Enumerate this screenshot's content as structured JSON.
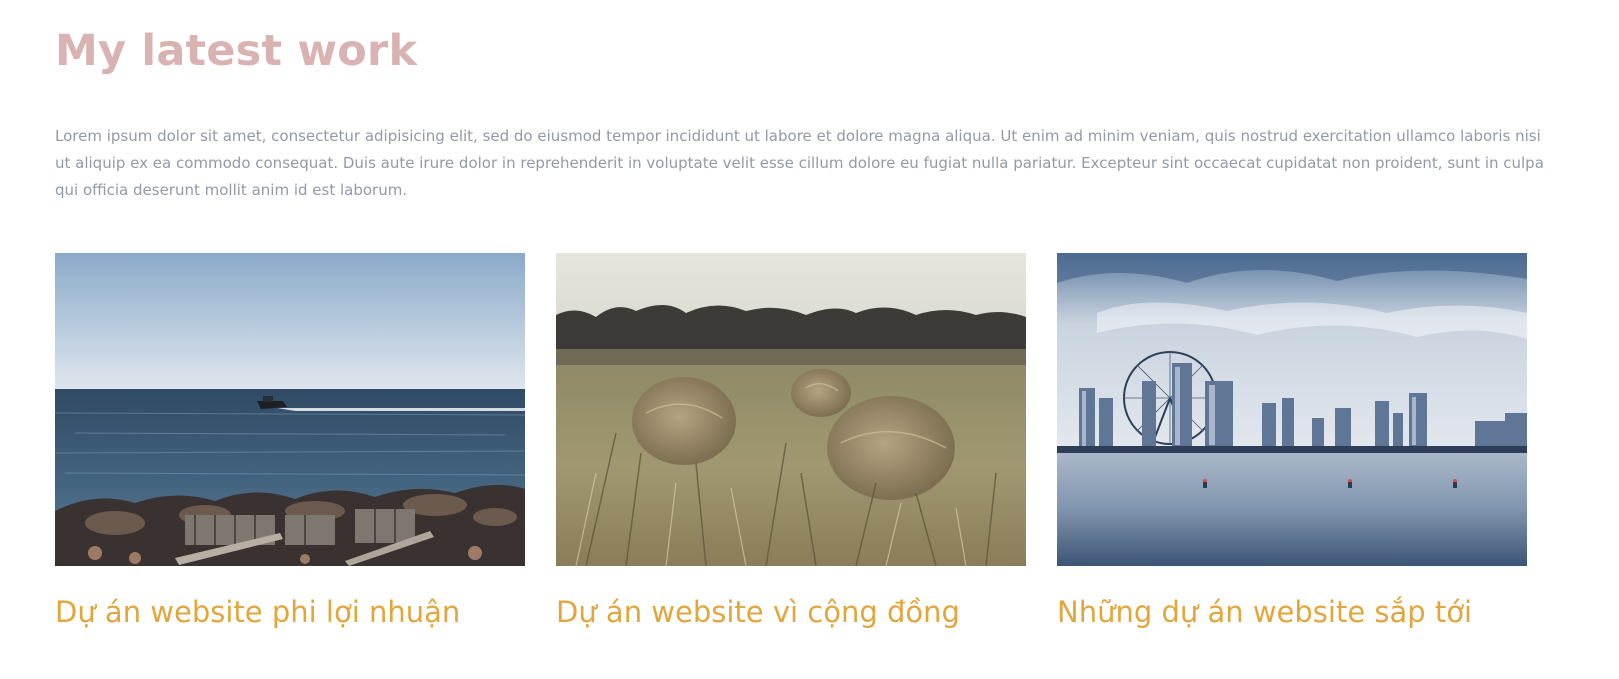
{
  "section": {
    "title": "My latest work",
    "intro": "Lorem ipsum dolor sit amet, consectetur adipisicing elit, sed do eiusmod tempor incididunt ut labore et dolore magna aliqua. Ut enim ad minim veniam, quis nostrud exercitation ullamco laboris nisi ut aliquip ex ea commodo consequat. Duis aute irure dolor in reprehenderit in voluptate velit esse cillum dolore eu fugiat nulla pariatur. Excepteur sint occaecat cupidatat non proident, sunt in culpa qui officia deserunt mollit anim id est laborum."
  },
  "projects": [
    {
      "title": "Dự án website phi lợi nhuận",
      "image": "speedboat-sea-photo"
    },
    {
      "title": "Dự án website vì cộng đồng",
      "image": "hay-bales-field-photo"
    },
    {
      "title": "Những dự án website sắp tới",
      "image": "city-skyline-ferris-wheel-photo"
    }
  ],
  "colors": {
    "title": "#d8b3b1",
    "body_text": "#9499a6",
    "accent": "#e2a63d",
    "background": "#ffffff"
  }
}
